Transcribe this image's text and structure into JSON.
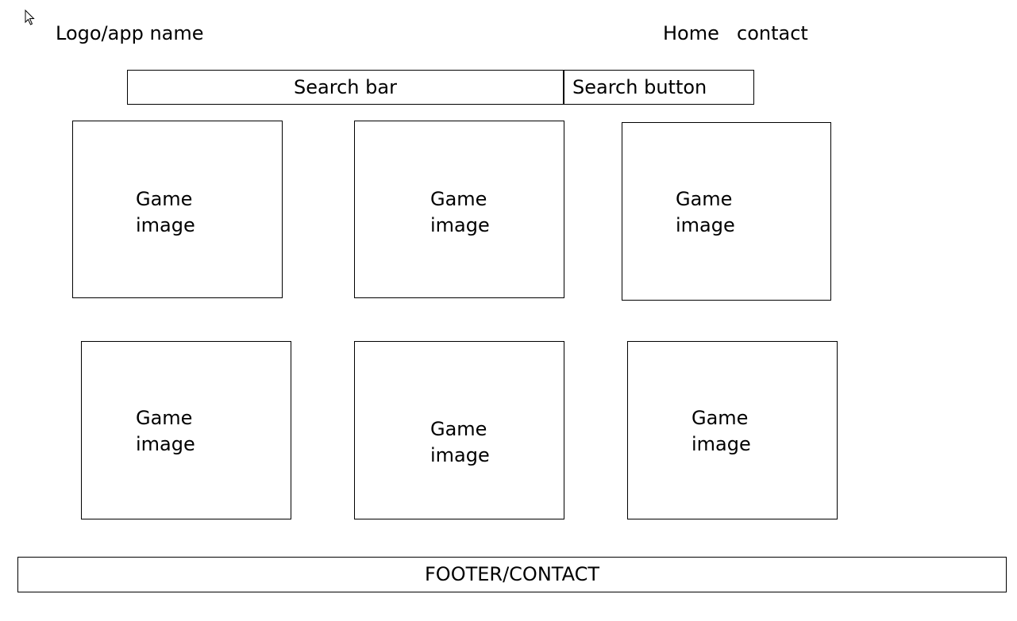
{
  "header": {
    "logo": "Logo/app name",
    "nav": {
      "home": "Home",
      "contact": "contact"
    }
  },
  "search": {
    "placeholder": "Search bar",
    "button_label": "Search button"
  },
  "games": [
    {
      "label": "Game image"
    },
    {
      "label": "Game image"
    },
    {
      "label": "Game image"
    },
    {
      "label": "Game image"
    },
    {
      "label": "Game image"
    },
    {
      "label": "Game image"
    }
  ],
  "footer": {
    "label": "FOOTER/CONTACT"
  },
  "icons": {
    "cursor": "mouse-pointer-icon"
  }
}
